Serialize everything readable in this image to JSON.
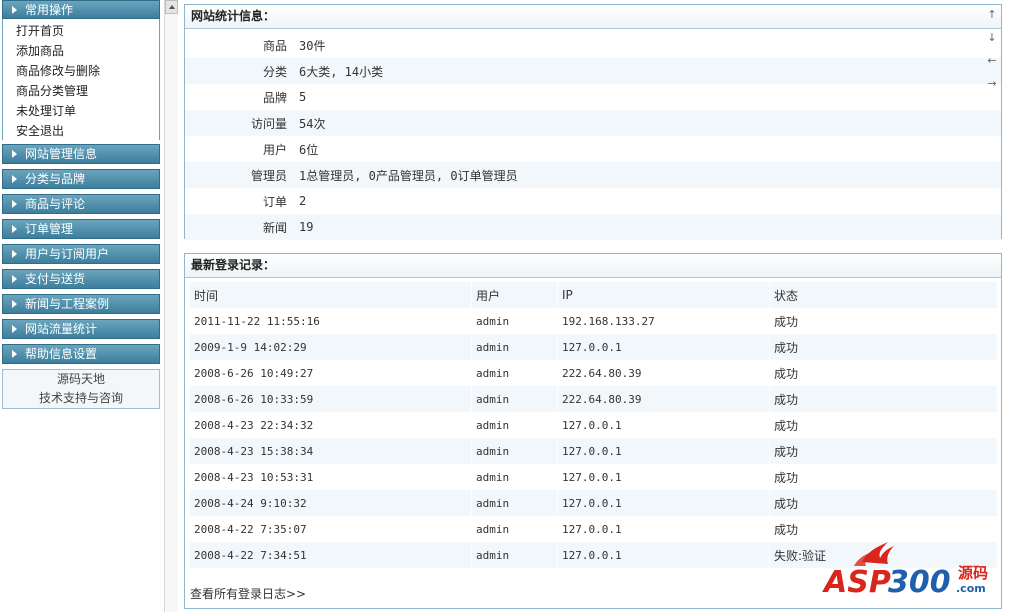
{
  "sidebar": {
    "common_section": "常用操作",
    "menu_items": [
      "打开首页",
      "添加商品",
      "商品修改与删除",
      "商品分类管理",
      "未处理订单",
      "安全退出"
    ],
    "sections": [
      "网站管理信息",
      "分类与品牌",
      "商品与评论",
      "订单管理",
      "用户与订阅用户",
      "支付与送货",
      "新闻与工程案例",
      "网站流量统计",
      "帮助信息设置"
    ],
    "footer_links": [
      "源码天地",
      "技术支持与咨询"
    ]
  },
  "stats_panel": {
    "title": "网站统计信息：",
    "rows": [
      {
        "label": "商品",
        "value": "30件"
      },
      {
        "label": "分类",
        "value": "6大类, 14小类"
      },
      {
        "label": "品牌",
        "value": "5"
      },
      {
        "label": "访问量",
        "value": "54次"
      },
      {
        "label": "用户",
        "value": "6位"
      },
      {
        "label": "管理员",
        "value": "1总管理员, 0产品管理员, 0订单管理员"
      },
      {
        "label": "订单",
        "value": "2"
      },
      {
        "label": "新闻",
        "value": "19"
      }
    ],
    "arrows": [
      "↑",
      "↓",
      "←",
      "→"
    ]
  },
  "login_panel": {
    "title": "最新登录记录：",
    "headers": [
      "时间",
      "用户",
      "IP",
      "状态"
    ],
    "rows": [
      [
        "2011-11-22 11:55:16",
        "admin",
        "192.168.133.27",
        "成功"
      ],
      [
        "2009-1-9 14:02:29",
        "admin",
        "127.0.0.1",
        "成功"
      ],
      [
        "2008-6-26 10:49:27",
        "admin",
        "222.64.80.39",
        "成功"
      ],
      [
        "2008-6-26 10:33:59",
        "admin",
        "222.64.80.39",
        "成功"
      ],
      [
        "2008-4-23 22:34:32",
        "admin",
        "127.0.0.1",
        "成功"
      ],
      [
        "2008-4-23 15:38:34",
        "admin",
        "127.0.0.1",
        "成功"
      ],
      [
        "2008-4-23 10:53:31",
        "admin",
        "127.0.0.1",
        "成功"
      ],
      [
        "2008-4-24 9:10:32",
        "admin",
        "127.0.0.1",
        "成功"
      ],
      [
        "2008-4-22 7:35:07",
        "admin",
        "127.0.0.1",
        "成功"
      ],
      [
        "2008-4-22 7:34:51",
        "admin",
        "127.0.0.1",
        "失败:验证"
      ]
    ],
    "view_all": "查看所有登录日志>>"
  },
  "watermark": {
    "text": "ASP300",
    "suffix": "源码",
    "domain": ".com"
  },
  "colors": {
    "sidebar_header": "#3c7f9d",
    "panel_border": "#8fb6cb",
    "row_stripe": "#f2f7fb",
    "logo_red": "#d9261c",
    "logo_blue": "#1f5fae"
  }
}
